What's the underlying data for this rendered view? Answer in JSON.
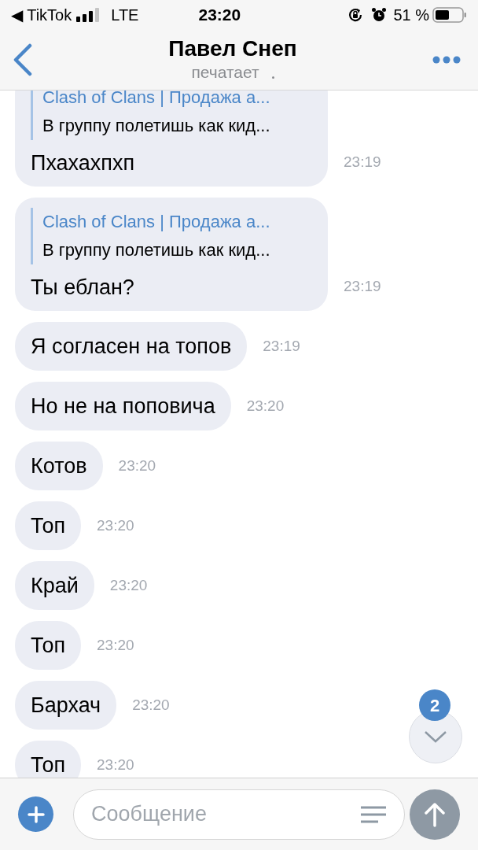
{
  "status_bar": {
    "back_app": "◀ TikTok",
    "network": "LTE",
    "time": "23:20",
    "battery_percent": "51 %"
  },
  "header": {
    "title": "Павел Снеп",
    "subtitle": "печатает"
  },
  "messages": [
    {
      "kind": "reply",
      "quote_title": "Clash of Clans | Продажа а...",
      "quote_text": "В группу полетишь как кид...",
      "text": "Пхахахпхп",
      "time": "23:19"
    },
    {
      "kind": "reply",
      "quote_title": "Clash of Clans | Продажа а...",
      "quote_text": "В группу полетишь как кид...",
      "text": "Ты еблан?",
      "time": "23:19"
    },
    {
      "kind": "text",
      "text": "Я согласен на топов",
      "time": "23:19"
    },
    {
      "kind": "text",
      "text": "Но не на поповича",
      "time": "23:20"
    },
    {
      "kind": "text",
      "text": "Котов",
      "time": "23:20"
    },
    {
      "kind": "text",
      "text": "Топ",
      "time": "23:20"
    },
    {
      "kind": "text",
      "text": "Край",
      "time": "23:20"
    },
    {
      "kind": "text",
      "text": "Топ",
      "time": "23:20"
    },
    {
      "kind": "text",
      "text": "Бархач",
      "time": "23:20"
    },
    {
      "kind": "text",
      "text": "Топ",
      "time": "23:20"
    }
  ],
  "scroll_down": {
    "badge": "2"
  },
  "composer": {
    "placeholder": "Сообщение"
  }
}
